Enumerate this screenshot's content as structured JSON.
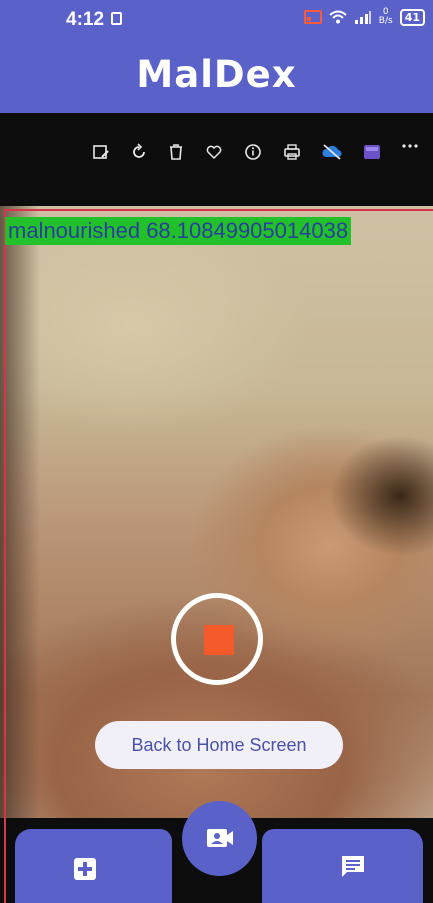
{
  "status_bar": {
    "time": "4:12",
    "net_speed_value": "0",
    "net_speed_unit": "B/s",
    "battery": "41"
  },
  "app_bar": {
    "title": "MalDex"
  },
  "gallery_toolbar": {
    "icons": [
      "edit-image-icon",
      "rotate-icon",
      "delete-icon",
      "favorite-icon",
      "info-icon",
      "print-icon",
      "cloud-off-icon",
      "app-icon",
      "more-icon"
    ]
  },
  "detection": {
    "label": "malnourished 68.10849905014038"
  },
  "buttons": {
    "back_home": "Back to Home Screen"
  },
  "colors": {
    "primary": "#5a62c9",
    "detection_box": "#d8344a",
    "detection_label_bg": "#22c02a",
    "record_stop": "#f55a2c"
  }
}
